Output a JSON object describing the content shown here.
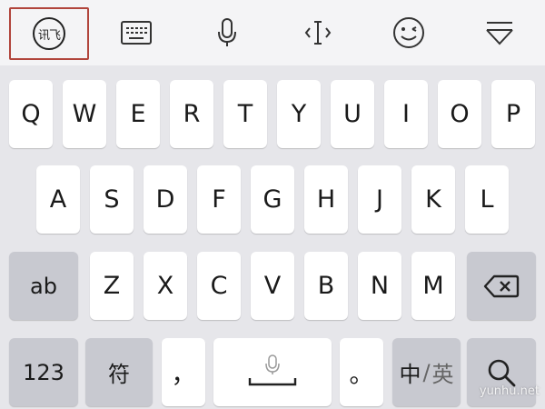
{
  "toolbar": {
    "logo_text": "讯飞",
    "items": [
      {
        "name": "iflytek-logo-icon"
      },
      {
        "name": "keyboard-icon"
      },
      {
        "name": "microphone-icon"
      },
      {
        "name": "text-cursor-icon"
      },
      {
        "name": "emoji-icon"
      },
      {
        "name": "collapse-keyboard-icon"
      }
    ]
  },
  "keyboard": {
    "row1": [
      "Q",
      "W",
      "E",
      "R",
      "T",
      "Y",
      "U",
      "I",
      "O",
      "P"
    ],
    "row2": [
      "A",
      "S",
      "D",
      "F",
      "G",
      "H",
      "J",
      "K",
      "L"
    ],
    "row3": [
      "Z",
      "X",
      "C",
      "V",
      "B",
      "N",
      "M"
    ],
    "ab_label": "ab",
    "backspace_icon": "backspace-icon",
    "num_label": "123",
    "symbol_label": "符",
    "comma_label": "，",
    "space_icon": "space-mic-icon",
    "period_label": "。",
    "lang_primary": "中",
    "lang_sep": "/",
    "lang_secondary": "英",
    "search_icon": "search-icon"
  },
  "watermark": "yunhu.net",
  "colors": {
    "keyboard_bg": "#e6e6ea",
    "key_bg": "#ffffff",
    "func_key_bg": "#c8c9d0",
    "highlight_border": "#b1453c"
  }
}
